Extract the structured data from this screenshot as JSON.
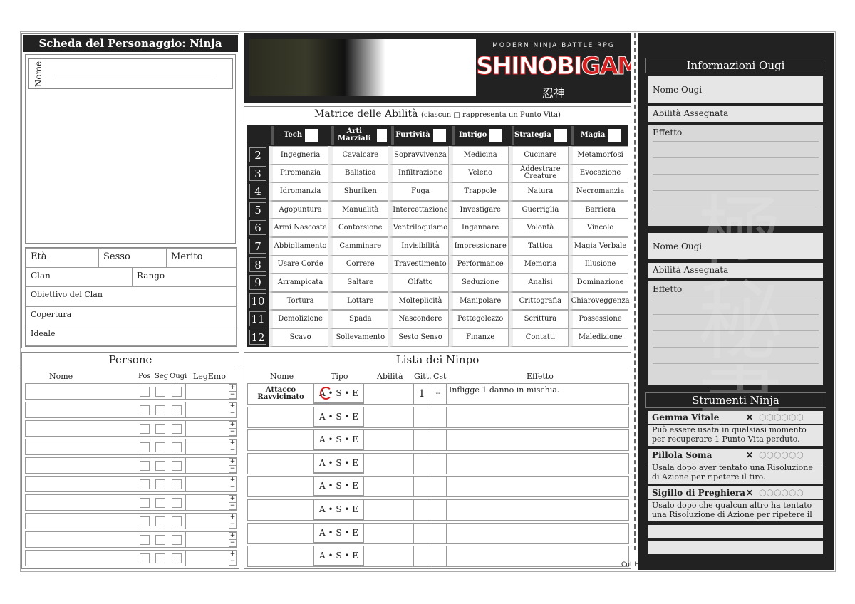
{
  "left": {
    "title": "Scheda del Personaggio: Ninja",
    "name_label": "Nome",
    "fields": {
      "eta": "Età",
      "sesso": "Sesso",
      "merito": "Merito",
      "clan": "Clan",
      "rango": "Rango",
      "obiettivo": "Obiettivo del Clan",
      "copertura": "Copertura",
      "ideale": "Ideale"
    }
  },
  "persone": {
    "title": "Persone",
    "columns": [
      "Nome",
      "Pos",
      "Seg",
      "Ougi",
      "LegEmo"
    ],
    "plus": "+",
    "minus": "−",
    "row_count": 10
  },
  "banner": {
    "tagline": "MODERN NINJA BATTLE RPG",
    "logo_a": "SHINOBI",
    "logo_b": "GAMI",
    "kanji": "忍神"
  },
  "matrix": {
    "title": "Matrice delle Abilità",
    "subtitle": "(ciascun □ rappresenta un Punto Vita)",
    "categories": [
      "Tech",
      "Arti Marziali",
      "Furtività",
      "Intrigo",
      "Strategia",
      "Magia"
    ],
    "rows": [
      {
        "n": "2",
        "skills": [
          "Ingegneria",
          "Cavalcare",
          "Sopravvivenza",
          "Medicina",
          "Cucinare",
          "Metamorfosi"
        ]
      },
      {
        "n": "3",
        "skills": [
          "Piromanzia",
          "Balistica",
          "Infiltrazione",
          "Veleno",
          "Addestrare Creature",
          "Evocazione"
        ]
      },
      {
        "n": "4",
        "skills": [
          "Idromanzia",
          "Shuriken",
          "Fuga",
          "Trappole",
          "Natura",
          "Necromanzia"
        ]
      },
      {
        "n": "5",
        "skills": [
          "Agopuntura",
          "Manualità",
          "Intercettazione",
          "Investigare",
          "Guerriglia",
          "Barriera"
        ]
      },
      {
        "n": "6",
        "skills": [
          "Armi Nascoste",
          "Contorsione",
          "Ventriloquismo",
          "Ingannare",
          "Volontà",
          "Vincolo"
        ]
      },
      {
        "n": "7",
        "skills": [
          "Abbigliamento",
          "Camminare",
          "Invisibilità",
          "Impressionare",
          "Tattica",
          "Magia Verbale"
        ]
      },
      {
        "n": "8",
        "skills": [
          "Usare Corde",
          "Correre",
          "Travestimento",
          "Performance",
          "Memoria",
          "Illusione"
        ]
      },
      {
        "n": "9",
        "skills": [
          "Arrampicata",
          "Saltare",
          "Olfatto",
          "Seduzione",
          "Analisi",
          "Dominazione"
        ]
      },
      {
        "n": "10",
        "skills": [
          "Tortura",
          "Lottare",
          "Molteplicità",
          "Manipolare",
          "Crittografia",
          "Chiaroveggenza"
        ]
      },
      {
        "n": "11",
        "skills": [
          "Demolizione",
          "Spada",
          "Nascondere",
          "Pettegolezzo",
          "Scrittura",
          "Possessione"
        ]
      },
      {
        "n": "12",
        "skills": [
          "Scavo",
          "Sollevamento",
          "Sesto Senso",
          "Finanze",
          "Contatti",
          "Maledizione"
        ]
      }
    ]
  },
  "ninpo": {
    "title": "Lista dei Ninpo",
    "columns": [
      "Nome",
      "Tipo",
      "Abilità",
      "Gitt.",
      "Cst",
      "Effetto"
    ],
    "rows": [
      {
        "nome": "Attacco Ravvicinato",
        "tipo": "A • S • E",
        "abilita": "",
        "gitt": "1",
        "cst": "--",
        "effetto": "Infligge 1 danno in mischia.",
        "circled": "A"
      },
      {
        "nome": "",
        "tipo": "A • S • E",
        "abilita": "",
        "gitt": "",
        "cst": "",
        "effetto": ""
      },
      {
        "nome": "",
        "tipo": "A • S • E",
        "abilita": "",
        "gitt": "",
        "cst": "",
        "effetto": ""
      },
      {
        "nome": "",
        "tipo": "A • S • E",
        "abilita": "",
        "gitt": "",
        "cst": "",
        "effetto": ""
      },
      {
        "nome": "",
        "tipo": "A • S • E",
        "abilita": "",
        "gitt": "",
        "cst": "",
        "effetto": ""
      },
      {
        "nome": "",
        "tipo": "A • S • E",
        "abilita": "",
        "gitt": "",
        "cst": "",
        "effetto": ""
      },
      {
        "nome": "",
        "tipo": "A • S • E",
        "abilita": "",
        "gitt": "",
        "cst": "",
        "effetto": ""
      },
      {
        "nome": "",
        "tipo": "A • S • E",
        "abilita": "",
        "gitt": "",
        "cst": "",
        "effetto": ""
      }
    ]
  },
  "ougi": {
    "title": "Informazioni Ougi",
    "name_label": "Nome Ougi",
    "skill_label": "Abilità Assegnata",
    "effect_label": "Effetto",
    "blocks": 2
  },
  "tools": {
    "title": "Strumenti Ninja",
    "x_mark": "✕",
    "items": [
      {
        "name": "Gemma Vitale",
        "desc": "Può essere usata in qualsiasi momento per recuperare 1 Punto Vita perduto.",
        "max": 6
      },
      {
        "name": "Pillola Soma",
        "desc": "Usala dopo aver tentato una Risoluzione di Azione per ripetere il tiro.",
        "max": 6
      },
      {
        "name": "Sigillo di Preghiera",
        "desc": "Usalo dopo che qualcun altro ha tentato una Risoluzione di Azione per ripetere il tiro.",
        "max": 6
      }
    ]
  },
  "cut_here": "Cut Here",
  "colors": {
    "dark": "#222222",
    "accent": "#d42020",
    "panel": "#e6e6e6"
  }
}
